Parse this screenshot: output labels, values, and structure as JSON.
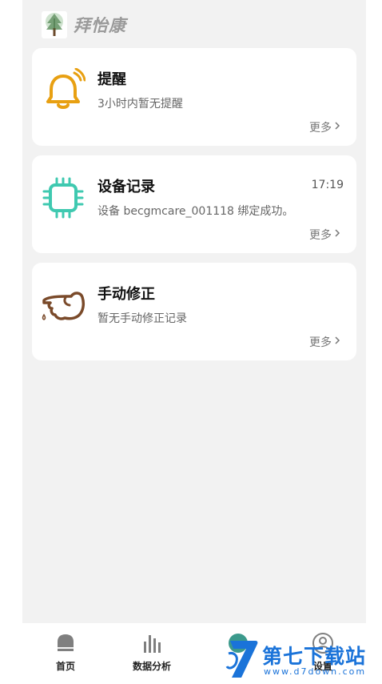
{
  "brand": {
    "name": "拜怡康",
    "logo_icon": "tree-logo-icon"
  },
  "cards": [
    {
      "icon": "bell-icon",
      "title": "提醒",
      "time": "",
      "subtitle": "3小时内暂无提醒",
      "more": "更多"
    },
    {
      "icon": "chip-icon",
      "title": "设备记录",
      "time": "17:19",
      "subtitle": "设备 becgmcare_001118 绑定成功。",
      "more": "更多"
    },
    {
      "icon": "pointing-hand-icon",
      "title": "手动修正",
      "time": "",
      "subtitle": "暂无手动修正记录",
      "more": "更多"
    }
  ],
  "tabbar": {
    "items": [
      {
        "label": "首页",
        "icon": "home-icon"
      },
      {
        "label": "数据分析",
        "icon": "bar-chart-icon"
      },
      {
        "label": "",
        "icon": "records-icon"
      },
      {
        "label": "设置",
        "icon": "profile-icon"
      }
    ]
  },
  "watermark": {
    "title": "第七下载站",
    "url": "www.d7down.com"
  },
  "colors": {
    "bell": "#e8a012",
    "chip": "#3fc9b0",
    "hand": "#7a4a2a",
    "watermark": "#1a73d9",
    "background": "#f2f2f2"
  }
}
